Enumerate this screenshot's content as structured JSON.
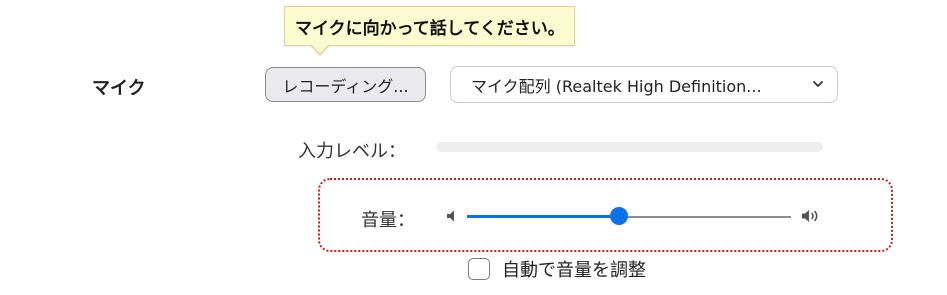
{
  "tooltip": {
    "text": "マイクに向かって話してください。"
  },
  "mic": {
    "section_label": "マイク",
    "record_button_label": "レコーディング...",
    "device_select_value": "マイク配列 (Realtek High Definition...",
    "input_level_label": "入力レベル：",
    "input_level": 0,
    "volume_label": "音量：",
    "volume_percent": 47,
    "auto_adjust_label": "自動で音量を調整",
    "auto_adjust_checked": false
  },
  "colors": {
    "accent": "#0e71eb",
    "highlight_border": "#c81a1a",
    "tooltip_bg": "#fdfbd0"
  },
  "icons": {
    "select_chevron": "chevron-down-icon",
    "volume_low": "speaker-low-icon",
    "volume_high": "speaker-high-icon"
  }
}
